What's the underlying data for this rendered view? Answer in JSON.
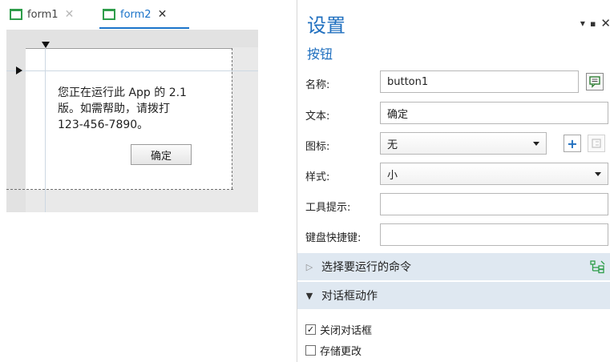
{
  "designer": {
    "tabs": [
      {
        "label": "form1",
        "close": "✕"
      },
      {
        "label": "form2",
        "close": "✕"
      }
    ],
    "dialog": {
      "message": "您正在运行此 App 的 2.1\n版。如需帮助，请拨打\n123-456-7890。",
      "ok_label": "确定"
    }
  },
  "panel": {
    "title": "设置",
    "subtitle": "按钮",
    "controls": {
      "menu": "▾",
      "pin": "▪",
      "close": "✕"
    },
    "fields": {
      "name": {
        "label": "名称:",
        "value": "button1"
      },
      "text": {
        "label": "文本:",
        "value": "确定"
      },
      "icon": {
        "label": "图标:",
        "value": "无"
      },
      "style": {
        "label": "样式:",
        "value": "小"
      },
      "tooltip": {
        "label": "工具提示:",
        "value": ""
      },
      "shortcut": {
        "label": "键盘快捷键:",
        "value": ""
      }
    },
    "sections": {
      "command": {
        "label": "选择要运行的命令",
        "arrow": "▷",
        "expanded": false
      },
      "dialog_action": {
        "label": "对话框动作",
        "arrow": "▼",
        "expanded": true
      }
    },
    "checkboxes": {
      "close_dialog": {
        "label": "关闭对话框",
        "checked": true
      },
      "store_changes": {
        "label": "存储更改",
        "checked": false
      }
    },
    "icons": [
      "message-icon",
      "plus-icon",
      "link-icon",
      "tree-icon",
      "form-icon"
    ],
    "colors": {
      "accent": "#1f6fbf",
      "section_bg": "#dfe8f1",
      "form_icon": "#2e9d4a"
    }
  }
}
